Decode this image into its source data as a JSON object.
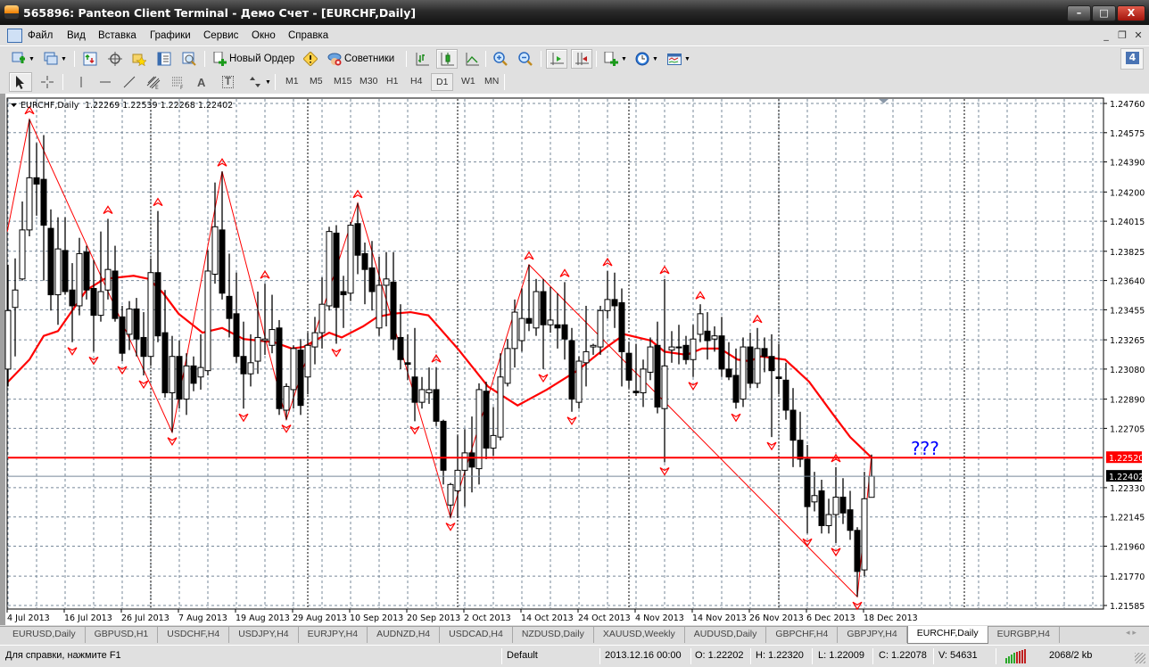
{
  "window": {
    "title": "565896: Panteon Client Terminal - Демо Счет - [EURCHF,Daily]",
    "minimize": "–",
    "maximize": "□",
    "close": "X"
  },
  "menu": {
    "items": [
      "Файл",
      "Вид",
      "Вставка",
      "Графики",
      "Сервис",
      "Окно",
      "Справка"
    ],
    "mdi": [
      "_",
      "❐",
      "✕"
    ]
  },
  "toolbar": {
    "new_order": "Новый Ордер",
    "experts": "Советники",
    "notifications": "4"
  },
  "timeframes": [
    "M1",
    "M5",
    "M15",
    "M30",
    "H1",
    "H4",
    "D1",
    "W1",
    "MN"
  ],
  "active_timeframe": "D1",
  "drawing_tools": {
    "text": "A",
    "label": "T"
  },
  "chart": {
    "header_symbol": "EURCHF,Daily",
    "header_ohlc": "1.22269 1.22539 1.22268 1.22402",
    "annotation": "???",
    "resistance_label": "1.22520",
    "bid_label": "1.22402"
  },
  "chart_data": {
    "type": "candlestick",
    "symbol": "EURCHF",
    "timeframe": "Daily",
    "ylim": [
      1.21585,
      1.2476
    ],
    "price_ticks": [
      "1.24760",
      "1.24575",
      "1.24390",
      "1.24200",
      "1.24015",
      "1.23825",
      "1.23640",
      "1.23455",
      "1.23265",
      "1.23080",
      "1.22890",
      "1.22705",
      "1.22330",
      "1.22145",
      "1.21960",
      "1.21770",
      "1.21585"
    ],
    "date_ticks": [
      [
        "4 Jul 2013",
        0
      ],
      [
        "16 Jul 2013",
        8
      ],
      [
        "26 Jul 2013",
        16
      ],
      [
        "7 Aug 2013",
        24
      ],
      [
        "19 Aug 2013",
        32
      ],
      [
        "29 Aug 2013",
        40
      ],
      [
        "10 Sep 2013",
        48
      ],
      [
        "20 Sep 2013",
        56
      ],
      [
        "2 Oct 2013",
        64
      ],
      [
        "14 Oct 2013",
        72
      ],
      [
        "24 Oct 2013",
        80
      ],
      [
        "4 Nov 2013",
        88
      ],
      [
        "14 Nov 2013",
        96
      ],
      [
        "26 Nov 2013",
        104
      ],
      [
        "6 Dec 2013",
        112
      ],
      [
        "18 Dec 2013",
        120
      ]
    ],
    "ohlc": [
      [
        1.2308,
        1.2374,
        1.2297,
        1.2345
      ],
      [
        1.2347,
        1.2378,
        1.2316,
        1.2358
      ],
      [
        1.2365,
        1.2414,
        1.2364,
        1.2396
      ],
      [
        1.2396,
        1.2466,
        1.2392,
        1.2429
      ],
      [
        1.2429,
        1.2451,
        1.2405,
        1.2425
      ],
      [
        1.2428,
        1.2456,
        1.2364,
        1.2399
      ],
      [
        1.2397,
        1.2409,
        1.2345,
        1.2355
      ],
      [
        1.2355,
        1.2404,
        1.2336,
        1.2384
      ],
      [
        1.2383,
        1.2404,
        1.2355,
        1.2357
      ],
      [
        1.2358,
        1.2375,
        1.2325,
        1.2348
      ],
      [
        1.2348,
        1.2391,
        1.2342,
        1.2381
      ],
      [
        1.2382,
        1.2386,
        1.2352,
        1.2358
      ],
      [
        1.2359,
        1.2377,
        1.2319,
        1.2342
      ],
      [
        1.2342,
        1.2395,
        1.2338,
        1.2357
      ],
      [
        1.2358,
        1.2403,
        1.2352,
        1.2371
      ],
      [
        1.237,
        1.2386,
        1.2338,
        1.234
      ],
      [
        1.2341,
        1.2348,
        1.2313,
        1.2318
      ],
      [
        1.233,
        1.2351,
        1.232,
        1.2346
      ],
      [
        1.2346,
        1.2353,
        1.2316,
        1.2327
      ],
      [
        1.2328,
        1.2344,
        1.2304,
        1.2316
      ],
      [
        1.2316,
        1.2378,
        1.231,
        1.2369
      ],
      [
        1.2369,
        1.2408,
        1.2325,
        1.2329
      ],
      [
        1.2331,
        1.2358,
        1.229,
        1.2293
      ],
      [
        1.2293,
        1.2329,
        1.2268,
        1.2316
      ],
      [
        1.2316,
        1.2326,
        1.2283,
        1.2289
      ],
      [
        1.2289,
        1.2318,
        1.2279,
        1.231
      ],
      [
        1.231,
        1.2316,
        1.2294,
        1.2299
      ],
      [
        1.2303,
        1.233,
        1.2295,
        1.2309
      ],
      [
        1.2307,
        1.2383,
        1.2304,
        1.237
      ],
      [
        1.2368,
        1.2426,
        1.2362,
        1.2398
      ],
      [
        1.2396,
        1.2433,
        1.2352,
        1.2356
      ],
      [
        1.2354,
        1.2381,
        1.2328,
        1.234
      ],
      [
        1.2343,
        1.2369,
        1.2312,
        1.2316
      ],
      [
        1.2316,
        1.2338,
        1.2283,
        1.2305
      ],
      [
        1.2305,
        1.233,
        1.2297,
        1.2312
      ],
      [
        1.2313,
        1.2357,
        1.2305,
        1.2328
      ],
      [
        1.2326,
        1.2362,
        1.2317,
        1.2327
      ],
      [
        1.2323,
        1.2355,
        1.2318,
        1.2333
      ],
      [
        1.2334,
        1.2339,
        1.2279,
        1.2283
      ],
      [
        1.2282,
        1.2299,
        1.2276,
        1.2297
      ],
      [
        1.2295,
        1.2323,
        1.2283,
        1.2321
      ],
      [
        1.232,
        1.2327,
        1.2279,
        1.2285
      ],
      [
        1.2303,
        1.2331,
        1.2292,
        1.2323
      ],
      [
        1.2322,
        1.2341,
        1.2311,
        1.2331
      ],
      [
        1.2331,
        1.2366,
        1.2321,
        1.2349
      ],
      [
        1.2348,
        1.2398,
        1.2345,
        1.2395
      ],
      [
        1.2394,
        1.2399,
        1.2324,
        1.2347
      ],
      [
        1.2357,
        1.2367,
        1.2334,
        1.2355
      ],
      [
        1.2356,
        1.2401,
        1.2351,
        1.2399
      ],
      [
        1.24,
        1.2413,
        1.2368,
        1.238
      ],
      [
        1.2381,
        1.2388,
        1.2349,
        1.2371
      ],
      [
        1.2372,
        1.2389,
        1.2345,
        1.2357
      ],
      [
        1.2334,
        1.2379,
        1.2329,
        1.2361
      ],
      [
        1.2361,
        1.2382,
        1.2335,
        1.2365
      ],
      [
        1.2363,
        1.2382,
        1.232,
        1.2327
      ],
      [
        1.2328,
        1.2349,
        1.2308,
        1.2314
      ],
      [
        1.2312,
        1.233,
        1.2301,
        1.2311
      ],
      [
        1.2303,
        1.2334,
        1.2275,
        1.2287
      ],
      [
        1.2287,
        1.2303,
        1.2283,
        1.2295
      ],
      [
        1.2293,
        1.2309,
        1.2286,
        1.2295
      ],
      [
        1.2295,
        1.2309,
        1.2272,
        1.2275
      ],
      [
        1.2275,
        1.2276,
        1.2235,
        1.2244
      ],
      [
        1.2222,
        1.2236,
        1.2214,
        1.2235
      ],
      [
        1.2231,
        1.2266,
        1.2214,
        1.2244
      ],
      [
        1.2244,
        1.227,
        1.2221,
        1.2255
      ],
      [
        1.2255,
        1.2278,
        1.223,
        1.2246
      ],
      [
        1.2245,
        1.2299,
        1.2235,
        1.2295
      ],
      [
        1.2294,
        1.23,
        1.2251,
        1.2258
      ],
      [
        1.2258,
        1.2284,
        1.2253,
        1.2266
      ],
      [
        1.2265,
        1.2318,
        1.2263,
        1.2303
      ],
      [
        1.2299,
        1.2327,
        1.2297,
        1.2321
      ],
      [
        1.2321,
        1.2352,
        1.2309,
        1.2344
      ],
      [
        1.2326,
        1.2359,
        1.2319,
        1.234
      ],
      [
        1.234,
        1.2374,
        1.2332,
        1.2337
      ],
      [
        1.2334,
        1.2365,
        1.2329,
        1.2357
      ],
      [
        1.2357,
        1.2365,
        1.2308,
        1.2336
      ],
      [
        1.2336,
        1.236,
        1.2331,
        1.2339
      ],
      [
        1.2336,
        1.2356,
        1.2321,
        1.2334
      ],
      [
        1.2336,
        1.2363,
        1.2314,
        1.2327
      ],
      [
        1.2326,
        1.2334,
        1.2281,
        1.2289
      ],
      [
        1.2287,
        1.2316,
        1.2283,
        1.2313
      ],
      [
        1.2312,
        1.2348,
        1.2297,
        1.2319
      ],
      [
        1.2322,
        1.2324,
        1.2317,
        1.2323
      ],
      [
        1.2322,
        1.2348,
        1.2317,
        1.2345
      ],
      [
        1.2345,
        1.237,
        1.234,
        1.2352
      ],
      [
        1.2352,
        1.2369,
        1.2334,
        1.2348
      ],
      [
        1.235,
        1.2359,
        1.2297,
        1.2319
      ],
      [
        1.2318,
        1.2325,
        1.2296,
        1.2301
      ],
      [
        1.2294,
        1.2324,
        1.2291,
        1.2293
      ],
      [
        1.2293,
        1.2314,
        1.2284,
        1.2308
      ],
      [
        1.2306,
        1.2328,
        1.2301,
        1.2322
      ],
      [
        1.2323,
        1.2338,
        1.228,
        1.2284
      ],
      [
        1.2283,
        1.2365,
        1.2249,
        1.231
      ],
      [
        1.232,
        1.2332,
        1.2312,
        1.2322
      ],
      [
        1.2322,
        1.2336,
        1.2311,
        1.2322
      ],
      [
        1.2323,
        1.2329,
        1.2311,
        1.2314
      ],
      [
        1.2314,
        1.2336,
        1.2303,
        1.2327
      ],
      [
        1.233,
        1.2349,
        1.2325,
        1.2343
      ],
      [
        1.2332,
        1.2344,
        1.2314,
        1.2326
      ],
      [
        1.2327,
        1.2335,
        1.2319,
        1.2329
      ],
      [
        1.2329,
        1.2341,
        1.2303,
        1.2308
      ],
      [
        1.2308,
        1.2325,
        1.2301,
        1.2303
      ],
      [
        1.2304,
        1.2321,
        1.2283,
        1.2287
      ],
      [
        1.2289,
        1.2328,
        1.2284,
        1.2322
      ],
      [
        1.2322,
        1.2331,
        1.2296,
        1.2299
      ],
      [
        1.2299,
        1.2334,
        1.2296,
        1.2321
      ],
      [
        1.2321,
        1.2328,
        1.2306,
        1.2316
      ],
      [
        1.2316,
        1.233,
        1.2265,
        1.2307
      ],
      [
        1.2303,
        1.2324,
        1.2292,
        1.2302
      ],
      [
        1.2301,
        1.2312,
        1.2276,
        1.2282
      ],
      [
        1.2282,
        1.2296,
        1.2246,
        1.2263
      ],
      [
        1.2263,
        1.2281,
        1.2246,
        1.2251
      ],
      [
        1.2251,
        1.226,
        1.2204,
        1.2221
      ],
      [
        1.2224,
        1.2243,
        1.2218,
        1.2228
      ],
      [
        1.2231,
        1.2238,
        1.2204,
        1.2209
      ],
      [
        1.2209,
        1.2226,
        1.2204,
        1.2216
      ],
      [
        1.2216,
        1.2246,
        1.2198,
        1.2227
      ],
      [
        1.2227,
        1.2239,
        1.221,
        1.2217
      ],
      [
        1.2219,
        1.2231,
        1.22,
        1.2206
      ],
      [
        1.2206,
        1.2208,
        1.2164,
        1.218
      ],
      [
        1.2181,
        1.2243,
        1.2177,
        1.2226
      ],
      [
        1.22269,
        1.22539,
        1.22268,
        1.22402
      ]
    ],
    "moving_average": [
      [
        0,
        1.23
      ],
      [
        3,
        1.2314
      ],
      [
        5,
        1.2329
      ],
      [
        7,
        1.2332
      ],
      [
        9,
        1.2345
      ],
      [
        11,
        1.2358
      ],
      [
        13.5,
        1.2365
      ],
      [
        15.5,
        1.2366
      ],
      [
        17.6,
        1.2367
      ],
      [
        19.75,
        1.2365
      ],
      [
        21.75,
        1.2356
      ],
      [
        23.9,
        1.2343
      ],
      [
        27.25,
        1.2331
      ],
      [
        30,
        1.2334
      ],
      [
        33,
        1.2327
      ],
      [
        37.25,
        1.2325
      ],
      [
        39.75,
        1.2321
      ],
      [
        41.4,
        1.2322
      ],
      [
        45,
        1.2331
      ],
      [
        46.75,
        1.2328
      ],
      [
        49.75,
        1.2335
      ],
      [
        51.75,
        1.2341
      ],
      [
        53.9,
        1.2343
      ],
      [
        56.4,
        1.2344
      ],
      [
        58.9,
        1.2342
      ],
      [
        63,
        1.2321
      ],
      [
        67.25,
        1.2297
      ],
      [
        71.4,
        1.2285
      ],
      [
        75.5,
        1.2295
      ],
      [
        79.75,
        1.2307
      ],
      [
        83.9,
        1.2322
      ],
      [
        86.4,
        1.233
      ],
      [
        90.1,
        1.2326
      ],
      [
        92,
        1.2319
      ],
      [
        95.1,
        1.2317
      ],
      [
        97.25,
        1.2321
      ],
      [
        99.75,
        1.2321
      ],
      [
        102.25,
        1.2314
      ],
      [
        103.9,
        1.2313
      ],
      [
        105.5,
        1.2316
      ],
      [
        108.9,
        1.2314
      ],
      [
        112.25,
        1.23
      ],
      [
        115.5,
        1.228
      ],
      [
        118,
        1.2265
      ],
      [
        121,
        1.2252
      ]
    ],
    "zigzag": [
      [
        -0.1,
        1.2395
      ],
      [
        3,
        1.2466
      ],
      [
        23,
        1.2268
      ],
      [
        30,
        1.2433
      ],
      [
        39,
        1.2276
      ],
      [
        49,
        1.2413
      ],
      [
        62,
        1.2214
      ],
      [
        73,
        1.2374
      ],
      [
        119,
        1.2164
      ],
      [
        121,
        1.22539
      ]
    ],
    "fractals_up": [
      3,
      14,
      21,
      30,
      36,
      49,
      60,
      73,
      78,
      84,
      92,
      97,
      105,
      116
    ],
    "fractals_down": [
      9,
      12,
      16,
      19,
      23,
      33,
      39,
      46,
      57,
      62,
      75,
      79,
      92,
      96,
      102,
      107,
      112,
      116,
      119
    ],
    "period_separators": [
      20,
      42,
      63,
      87,
      108,
      134
    ],
    "horizontal_line": 1.2252,
    "bid": 1.22402,
    "colors": {
      "line": "#ff0000",
      "grid": "#778899",
      "annotation": "#0000ff"
    }
  },
  "tabs": [
    "EURUSD,Daily",
    "GBPUSD,H1",
    "USDCHF,H4",
    "USDJPY,H4",
    "EURJPY,H4",
    "AUDNZD,H4",
    "USDCAD,H4",
    "NZDUSD,Daily",
    "XAUUSD,Weekly",
    "AUDUSD,Daily",
    "GBPCHF,H4",
    "GBPJPY,H4",
    "EURCHF,Daily",
    "EURGBP,H4"
  ],
  "active_tab": "EURCHF,Daily",
  "status": {
    "help": "Для справки, нажмите F1",
    "profile": "Default",
    "time": "2013.12.16 00:00",
    "open": "O: 1.22202",
    "high": "H: 1.22320",
    "low": "L: 1.22009",
    "close": "C: 1.22078",
    "volume": "V: 54631",
    "traffic": "2068/2 kb"
  }
}
